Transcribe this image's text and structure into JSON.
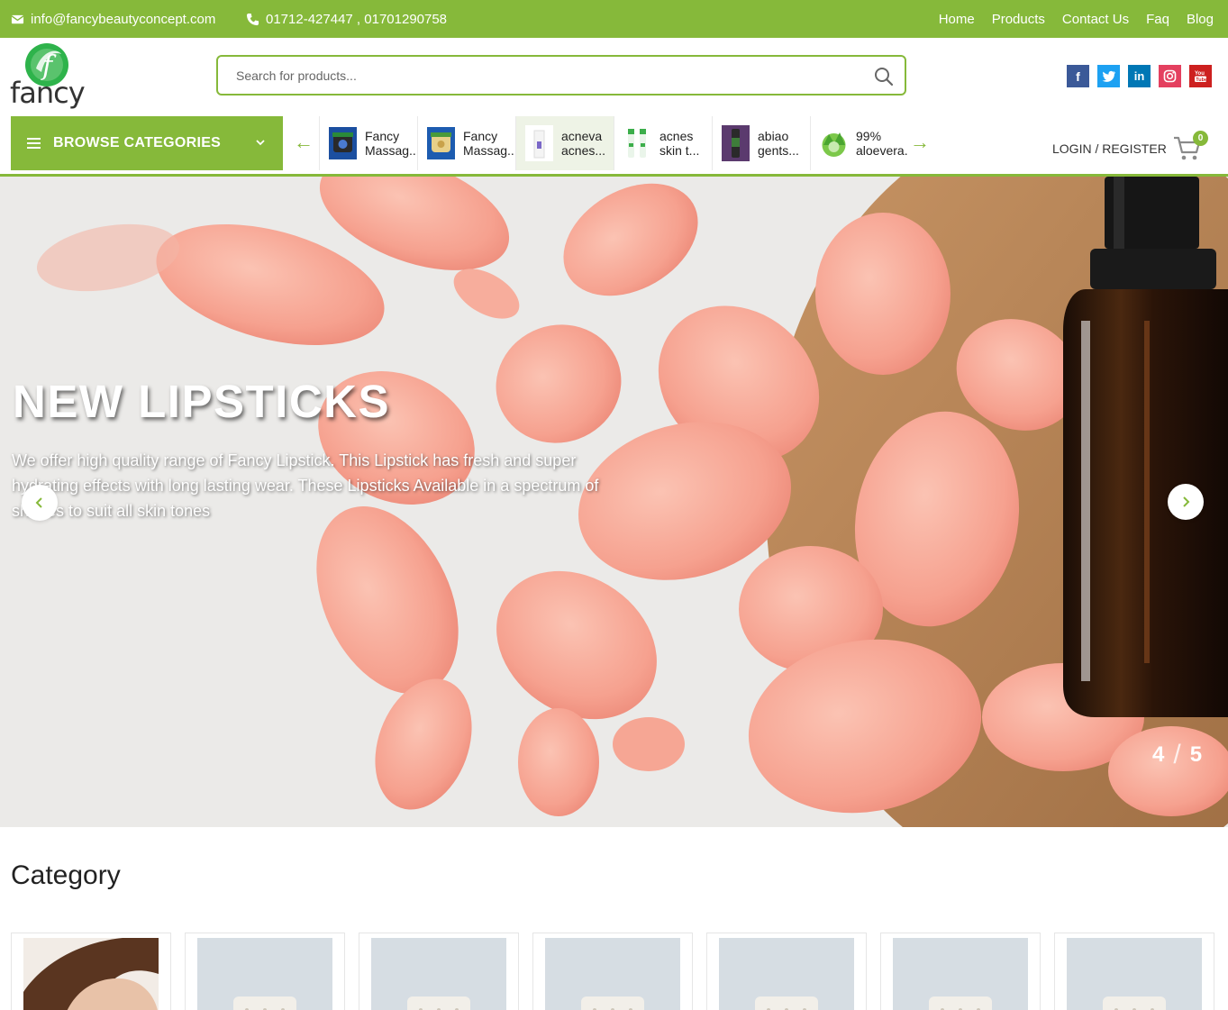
{
  "topbar": {
    "email": "info@fancybeautyconcept.com",
    "phone": "01712-427447 , 01701290758",
    "nav": [
      "Home",
      "Products",
      "Contact Us",
      "Faq",
      "Blog"
    ]
  },
  "brand": {
    "logo_text": "fancy",
    "logo_letter": "f"
  },
  "search": {
    "placeholder": "Search for products..."
  },
  "socials": [
    "facebook",
    "twitter",
    "linkedin",
    "instagram",
    "youtube"
  ],
  "browse": {
    "label": "BROWSE CATEGORIES"
  },
  "product_strip": [
    {
      "title": "Fancy\nMassag...",
      "thumb": "massage-jar-dark"
    },
    {
      "title": "Fancy\nMassag...",
      "thumb": "massage-jar-cream"
    },
    {
      "title": "acneva\nacnes...",
      "thumb": "acneva-box"
    },
    {
      "title": "acnes\nskin t...",
      "thumb": "acnes-bottles"
    },
    {
      "title": "abiao\ngents...",
      "thumb": "abiao-bottle"
    },
    {
      "title": "99%\naloevera.",
      "thumb": "aloevera-jar"
    }
  ],
  "account": {
    "login_label": "LOGIN / REGISTER",
    "cart_count": "0"
  },
  "hero": {
    "title": "NEW LIPSTICKS",
    "description": "We offer high quality range of Fancy Lipstick. This Lipstick has fresh and super hydrating effects with long lasting wear. These Lipsticks Available in a spectrum of shades to suit all skin tones",
    "current_slide": "4",
    "total_slides": "5"
  },
  "category": {
    "heading": "Category"
  },
  "colors": {
    "accent": "#86b93a",
    "white": "#ffffff"
  }
}
